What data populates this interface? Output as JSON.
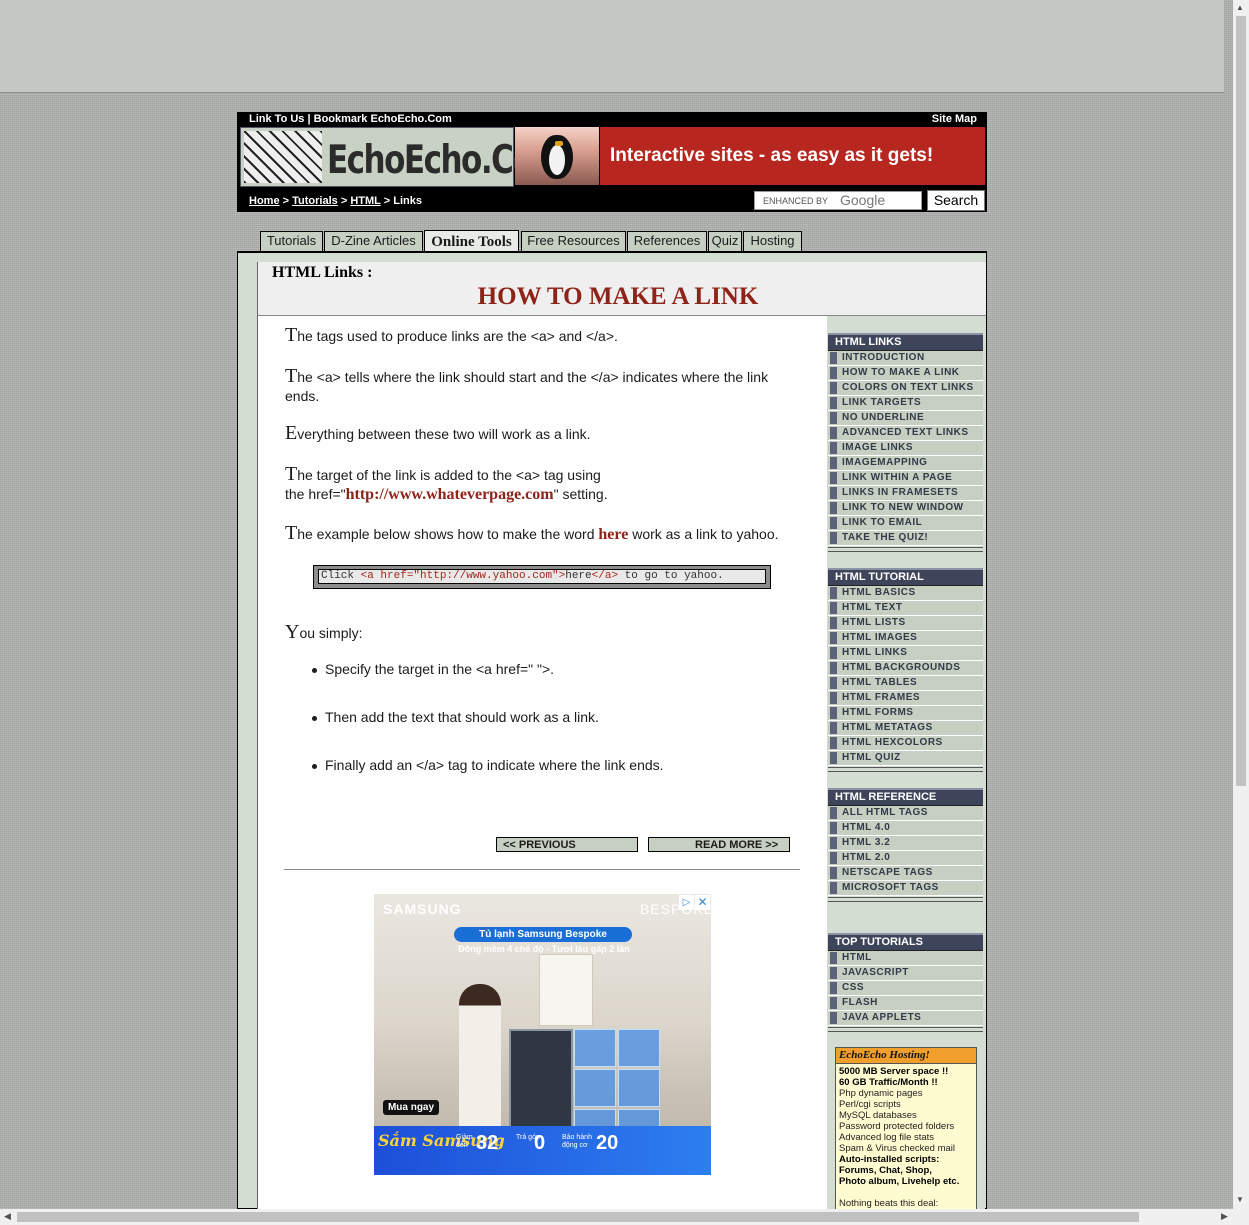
{
  "header": {
    "link_to_us": "Link To Us",
    "separator": "|",
    "bookmark": "Bookmark EchoEcho.Com",
    "site_map": "Site Map",
    "logo_text": "EchoEcho.Com",
    "banner": "Interactive sites - as easy as it gets!",
    "breadcrumb": {
      "home": "Home",
      "sep": ">",
      "tutorials": "Tutorials",
      "html": "HTML",
      "current": "Links"
    },
    "search": {
      "enhanced_by": "ENHANCED BY",
      "google": "Google",
      "button": "Search"
    }
  },
  "tabs": [
    "Tutorials",
    "D-Zine Articles",
    "Online Tools",
    "Free Resources",
    "References",
    "Quiz",
    "Hosting"
  ],
  "page": {
    "section": "HTML Links :",
    "title": "HOW TO MAKE A LINK"
  },
  "content": {
    "p1": {
      "cap": "T",
      "text": "he tags used to produce links are the <a> and </a>."
    },
    "p2": {
      "cap": "T",
      "text": "he <a> tells where the link should start and the </a> indicates where the link ends."
    },
    "p3": {
      "cap": "E",
      "text": "verything between these two will work as a link."
    },
    "p4": {
      "cap": "T",
      "text": "he target of the link is added to the <a> tag using",
      "line2_pre": "the href=\"",
      "url": "http://www.whateverpage.com",
      "line2_post": "\" setting."
    },
    "p5": {
      "cap": "T",
      "text_pre": "he example below shows how to make the word ",
      "here": "here",
      "text_post": " work as a link to yahoo."
    },
    "code": {
      "pre": "Click ",
      "open_tag": "<a href=\"http://www.yahoo.com\">",
      "mid": "here",
      "close_tag": "</a>",
      "post": " to go to yahoo."
    },
    "p6": {
      "cap": "Y",
      "text": "ou simply:"
    },
    "list": [
      "Specify the target in the <a href=\" \">.",
      "Then add the text that should work as a link.",
      "Finally add an </a> tag to indicate where the link ends."
    ],
    "prev": "<< PREVIOUS",
    "next": "READ MORE >>"
  },
  "ad": {
    "brand": "SAMSUNG",
    "bespoke": "BESPOKE",
    "headline": "Tủ lạnh Samsung Bespoke",
    "tagline": "Đông mềm 4 chế độ - Tươi lâu gấp 2 lần",
    "cta": "Mua ngay",
    "strip_title": "Sắm Samsung",
    "deal1": {
      "label": "Giảm đến",
      "value": "32"
    },
    "deal2": {
      "label": "Trả góp",
      "value": "0"
    },
    "deal3": {
      "label": "Bảo hành động cơ",
      "value": "20"
    }
  },
  "sidebar": {
    "html_links": {
      "title": "HTML LINKS",
      "items": [
        "INTRODUCTION",
        "HOW TO MAKE A LINK",
        "COLORS ON TEXT LINKS",
        "LINK TARGETS",
        "NO UNDERLINE",
        "ADVANCED TEXT LINKS",
        "IMAGE LINKS",
        "IMAGEMAPPING",
        "LINK WITHIN A PAGE",
        "LINKS IN FRAMESETS",
        "LINK TO NEW WINDOW",
        "LINK TO EMAIL",
        "TAKE THE QUIZ!"
      ]
    },
    "html_tutorial": {
      "title": "HTML TUTORIAL",
      "items": [
        "HTML BASICS",
        "HTML TEXT",
        "HTML LISTS",
        "HTML IMAGES",
        "HTML LINKS",
        "HTML BACKGROUNDS",
        "HTML TABLES",
        "HTML FRAMES",
        "HTML FORMS",
        "HTML METATAGS",
        "HTML HEXCOLORS",
        "HTML QUIZ"
      ]
    },
    "html_reference": {
      "title": "HTML REFERENCE",
      "items": [
        "ALL HTML TAGS",
        "HTML 4.0",
        "HTML 3.2",
        "HTML 2.0",
        "NETSCAPE TAGS",
        "MICROSOFT TAGS"
      ]
    },
    "top_tutorials": {
      "title": "TOP TUTORIALS",
      "items": [
        "HTML",
        "JAVASCRIPT",
        "CSS",
        "FLASH",
        "JAVA APPLETS"
      ]
    },
    "hosting": {
      "title": "EchoEcho Hosting!",
      "bold1": "5000 MB Server space !!",
      "bold2": "60 GB Traffic/Month !!",
      "features": [
        "Php dynamic pages",
        "Perl/cgi scripts",
        "MySQL databases",
        "Password protected folders",
        "Advanced log file stats",
        "Spam & Virus checked mail"
      ],
      "auto1": "Auto-installed scripts:",
      "auto2": "Forums, Chat, Shop,",
      "auto3": "Photo album, Livehelp etc.",
      "footer": "Nothing beats this deal:"
    }
  }
}
